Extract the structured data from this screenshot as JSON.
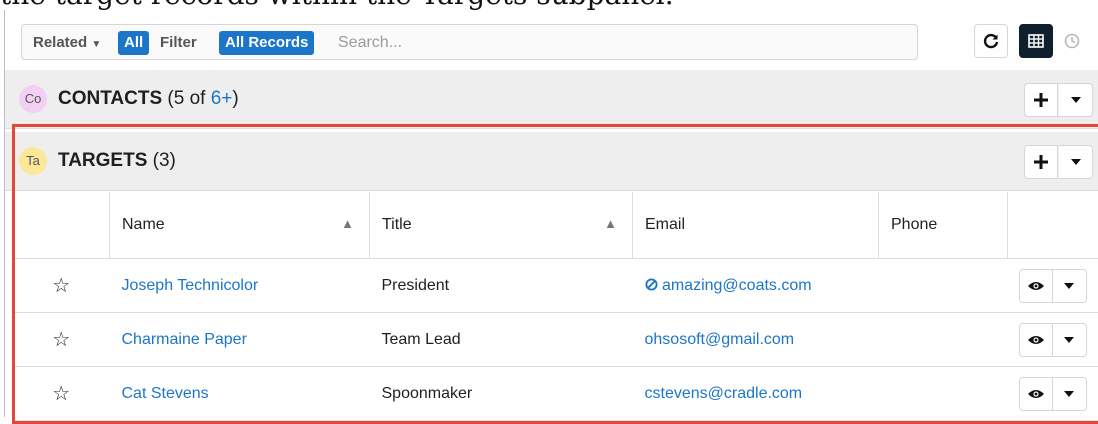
{
  "caption": "the target records within the Targets subpanel.",
  "toolbar": {
    "related_label": "Related",
    "related_value": "All",
    "filter_label": "Filter",
    "filter_value": "All Records",
    "search_placeholder": "Search..."
  },
  "contacts": {
    "avatar": "Co",
    "title": "CONTACTS",
    "count_prefix": "(5 of ",
    "count_link": "6+",
    "count_suffix": ")"
  },
  "targets": {
    "avatar": "Ta",
    "title": "TARGETS",
    "count": "(3)",
    "columns": [
      "Name",
      "Title",
      "Email",
      "Phone"
    ],
    "rows": [
      {
        "name": "Joseph Technicolor",
        "title": "President",
        "email": "amazing@coats.com",
        "phone": "",
        "opted_out": true
      },
      {
        "name": "Charmaine Paper",
        "title": "Team Lead",
        "email": "ohsosoft@gmail.com",
        "phone": "",
        "opted_out": false
      },
      {
        "name": "Cat Stevens",
        "title": "Spoonmaker",
        "email": "cstevens@cradle.com",
        "phone": "",
        "opted_out": false
      }
    ]
  },
  "colors": {
    "accent": "#1b76c9",
    "highlight": "#e04a3b",
    "contacts_avatar": "#f3d0f3",
    "targets_avatar": "#fbe99a"
  }
}
